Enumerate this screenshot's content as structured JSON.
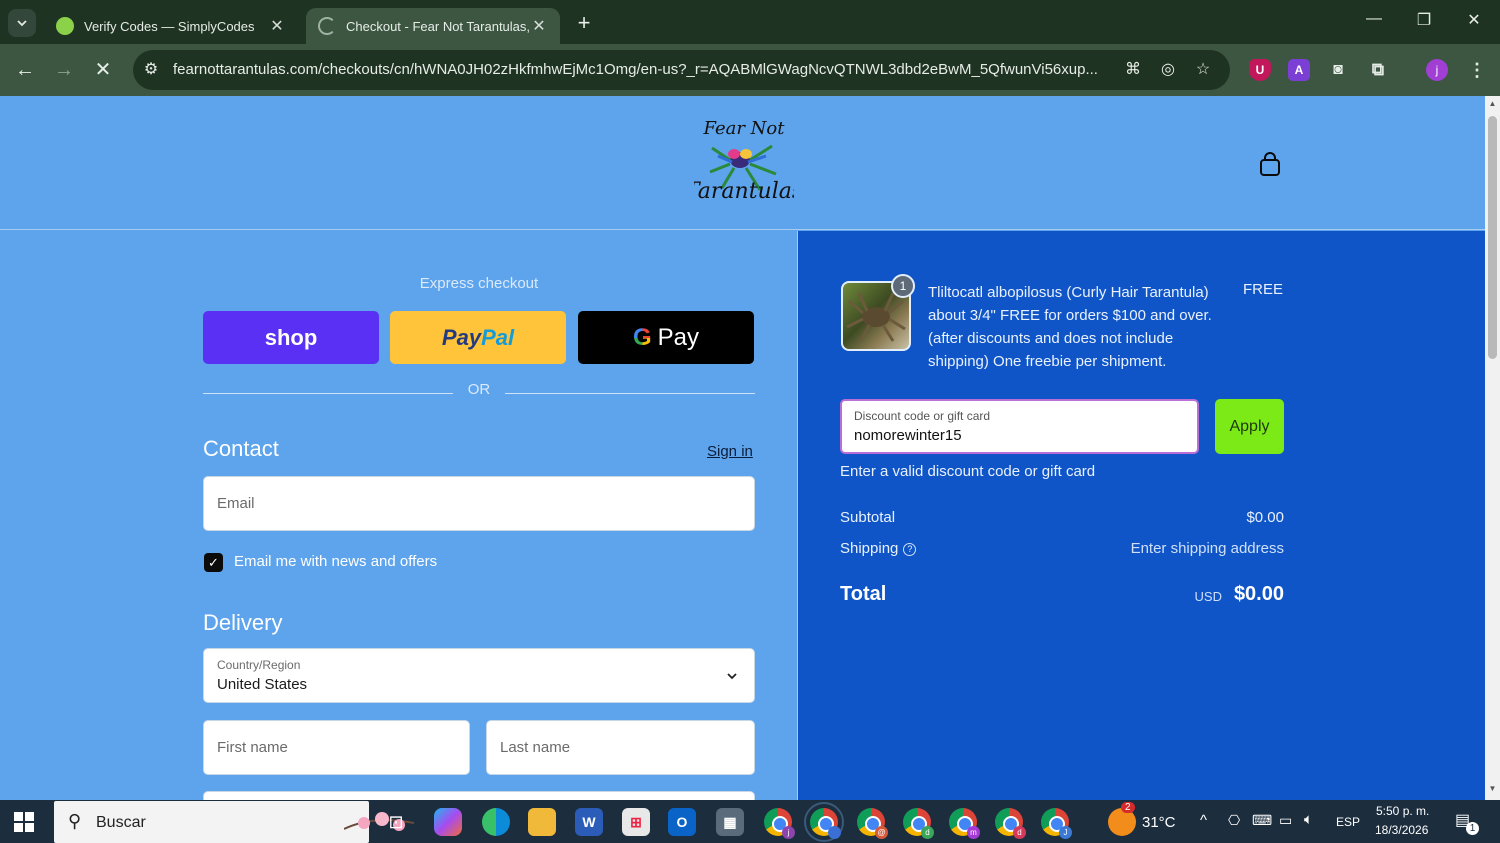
{
  "browser": {
    "tabs": [
      {
        "title": "Verify Codes — SimplyCodes",
        "active": false
      },
      {
        "title": "Checkout - Fear Not Tarantulas, LLC",
        "active": true
      }
    ],
    "url": "fearnottarantulas.com/checkouts/cn/hWNA0JH02zHkfmhwEjMc1Omg/en-us?_r=AQABMlGWagNcvQTNWL3dbd2eBwM_5QfwunVi56xup...",
    "profile_initial": "j"
  },
  "store": {
    "logo_top": "Fear Not",
    "logo_bottom": "Tarantulas"
  },
  "express": {
    "label": "Express checkout",
    "shop": "shop",
    "paypal": "PayPal",
    "gpay": "G Pay",
    "or": "OR"
  },
  "contact": {
    "title": "Contact",
    "sign_in": "Sign in",
    "email_placeholder": "Email",
    "newsletter_label": "Email me with news and offers",
    "newsletter_checked": true
  },
  "delivery": {
    "title": "Delivery",
    "country_label": "Country/Region",
    "country_value": "United States",
    "first_name_placeholder": "First name",
    "last_name_placeholder": "Last name"
  },
  "summary": {
    "item": {
      "quantity": "1",
      "description": "Tliltocatl albopilosus (Curly Hair Tarantula) about 3/4\" FREE for orders $100 and over. (after discounts and does not include shipping) One freebie per shipment.",
      "price": "FREE"
    },
    "discount_label": "Discount code or gift card",
    "discount_value": "nomorewinter15",
    "apply": "Apply",
    "error": "Enter a valid discount code or gift card",
    "subtotal_label": "Subtotal",
    "subtotal_value": "$0.00",
    "shipping_label": "Shipping",
    "shipping_value": "Enter shipping address",
    "total_label": "Total",
    "currency": "USD",
    "total_value": "$0.00"
  },
  "taskbar": {
    "search": "Buscar",
    "weather_badge": "2",
    "temperature": "31°C",
    "language": "ESP",
    "time": "5:50 p. m.",
    "date": "18/3/2026",
    "notifications": "1",
    "chrome_profiles": [
      "j",
      "",
      "@",
      "d",
      "m",
      "d",
      "J"
    ]
  },
  "colors": {
    "page_bg": "#5da4ec",
    "summary_bg": "#0f55c8",
    "apply_btn": "#7cea17",
    "shop_btn": "#5a31f4",
    "paypal_btn": "#ffc439"
  }
}
